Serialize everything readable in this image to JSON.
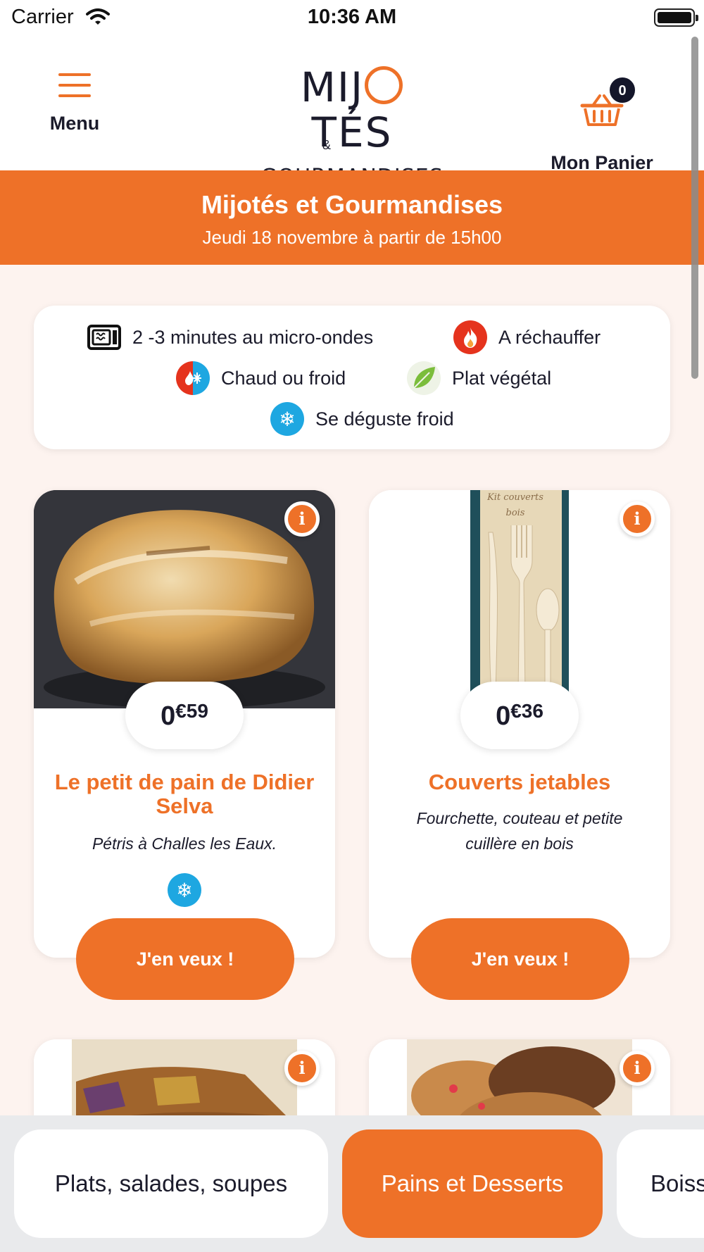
{
  "status_bar": {
    "carrier": "Carrier",
    "time": "10:36 AM"
  },
  "header": {
    "menu_label": "Menu",
    "logo_top_left": "MIJ",
    "logo_top_right": "TÉS",
    "logo_amp": "&",
    "logo_bottom": "GOURMANDISES",
    "cart_label": "Mon Panier",
    "cart_count": "0"
  },
  "banner": {
    "title": "Mijotés et Gourmandises",
    "subtitle": "Jeudi 18 novembre à partir de 15h00"
  },
  "legend": {
    "items": [
      {
        "icon": "microwave-icon",
        "label": "2 -3 minutes au micro-ondes"
      },
      {
        "icon": "flame-icon",
        "label": "A réchauffer"
      },
      {
        "icon": "hot-cold-icon",
        "label": "Chaud ou froid"
      },
      {
        "icon": "leaf-icon",
        "label": "Plat végétal"
      },
      {
        "icon": "snowflake-icon",
        "label": "Se déguste froid"
      }
    ]
  },
  "products": [
    {
      "price_int": "0",
      "price_dec": "€59",
      "title": "Le petit de pain de Didier Selva",
      "description": "Pétris à Challes les Eaux.",
      "badge": "snowflake-icon",
      "cta": "J'en veux !"
    },
    {
      "price_int": "0",
      "price_dec": "€36",
      "title": "Couverts jetables",
      "description": "Fourchette, couteau et petite cuillère en bois",
      "cta": "J'en veux !",
      "photo_text": "Kit couverts bois"
    }
  ],
  "tabs": [
    {
      "label": "Plats, salades, soupes",
      "active": false
    },
    {
      "label": "Pains et Desserts",
      "active": true
    },
    {
      "label": "Boissons",
      "active": false
    }
  ],
  "colors": {
    "accent": "#ee7128",
    "dark": "#1b1b2b",
    "background": "#fdf3ef",
    "snow": "#1ea7e1",
    "flame": "#e5331d"
  }
}
